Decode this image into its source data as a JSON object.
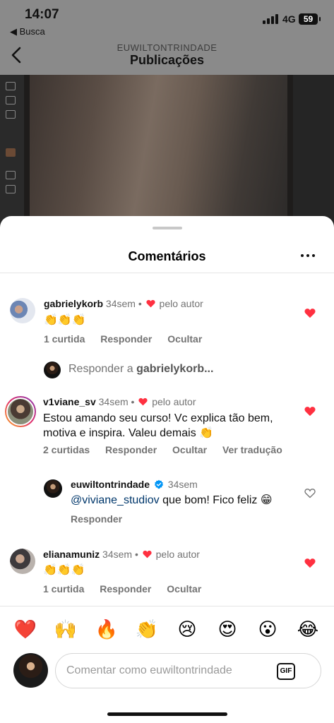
{
  "status_bar": {
    "time": "14:07",
    "back_label": "◀ Busca",
    "network": "4G",
    "battery": "59"
  },
  "header": {
    "username": "EUWILTONTRINDADE",
    "title": "Publicações"
  },
  "sheet": {
    "title": "Comentários"
  },
  "comments": [
    {
      "user": "gabrielykorb",
      "time": "34sem",
      "author_badge": "pelo autor",
      "text": "👏👏👏",
      "actions": [
        "1 curtida",
        "Responder",
        "Ocultar"
      ],
      "liked": true
    },
    {
      "user": "v1viane_sv",
      "time": "34sem",
      "author_badge": "pelo autor",
      "text": "Estou amando seu curso! Vc explica tão bem, motiva e inspira. Valeu demais 👏",
      "actions": [
        "2 curtidas",
        "Responder",
        "Ocultar",
        "Ver tradução"
      ],
      "liked": true
    },
    {
      "user": "elianamuniz",
      "time": "34sem",
      "author_badge": "pelo autor",
      "text": "👏👏👏",
      "actions": [
        "1 curtida",
        "Responder",
        "Ocultar"
      ],
      "liked": true
    }
  ],
  "reply_prompt": {
    "prefix": "Responder a ",
    "target": "gabrielykorb..."
  },
  "reply": {
    "user": "euwiltontrindade",
    "time": "34sem",
    "verified": true,
    "mention": "@viviane_studiov",
    "text": " que bom! Fico feliz 😁",
    "action": "Responder",
    "liked": false
  },
  "emoji_bar": [
    "❤️",
    "🙌",
    "🔥",
    "👏",
    "😢",
    "😍",
    "😮",
    "😂"
  ],
  "composer": {
    "placeholder": "Comentar como euwiltontrindade",
    "gif_label": "GIF"
  },
  "colors": {
    "like_red": "#ff3040",
    "verified_blue": "#0095f6",
    "mention_blue": "#00376b",
    "muted_text": "#737373"
  }
}
